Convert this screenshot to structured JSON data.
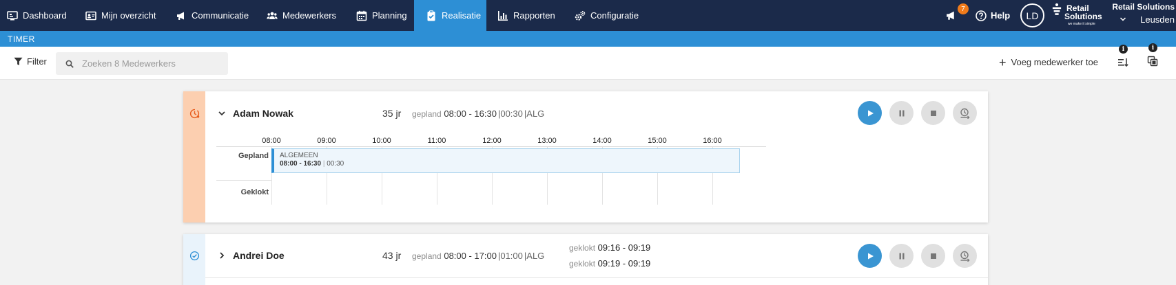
{
  "nav": {
    "items": [
      {
        "label": "Dashboard",
        "icon": "dashboard-icon"
      },
      {
        "label": "Mijn overzicht",
        "icon": "id-card-icon"
      },
      {
        "label": "Communicatie",
        "icon": "megaphone-icon"
      },
      {
        "label": "Medewerkers",
        "icon": "users-icon"
      },
      {
        "label": "Planning",
        "icon": "calendar-icon"
      },
      {
        "label": "Realisatie",
        "icon": "clipboard-icon"
      },
      {
        "label": "Rapporten",
        "icon": "bar-chart-icon"
      },
      {
        "label": "Configuratie",
        "icon": "cogs-icon"
      }
    ],
    "active": "Realisatie",
    "notifications_count": "7",
    "help_label": "Help",
    "avatar_initials": "LD",
    "brand_line1": "Retail",
    "brand_line2": "Solutions",
    "brand_tagline": "we make it simple",
    "company_name": "Retail Solutions",
    "location": "Leusden"
  },
  "subheader": {
    "title": "TIMER"
  },
  "toolbar": {
    "filter_label": "Filter",
    "search_placeholder": "Zoeken 8 Medewerkers",
    "add_employee_label": "Voeg medewerker toe",
    "info_glyph": "i"
  },
  "employees": [
    {
      "name": "Adam Nowak",
      "age": "35 jr",
      "scheduled_prefix": "gepland",
      "scheduled_time": "08:00 - 16:30",
      "scheduled_break": "|00:30",
      "scheduled_dept": "|ALG",
      "expanded": true,
      "status": "late-clock-icon",
      "strip_color": "#fccfb0",
      "timeline": {
        "hours": [
          "08:00",
          "09:00",
          "10:00",
          "11:00",
          "12:00",
          "13:00",
          "14:00",
          "15:00",
          "16:00"
        ],
        "row_planned": "Gepland",
        "row_clocked": "Geklokt",
        "shift": {
          "dept": "ALGEMEEN",
          "time": "08:00 - 16:30",
          "separator": "|",
          "break": "00:30",
          "start_hour": 8.0,
          "end_hour": 16.5
        }
      }
    },
    {
      "name": "Andrei Doe",
      "age": "43 jr",
      "scheduled_prefix": "gepland",
      "scheduled_time": "08:00 - 17:00",
      "scheduled_break": "|01:00",
      "scheduled_dept": "|ALG",
      "expanded": false,
      "status": "check-circle-icon",
      "strip_color": "#e9f3fb",
      "clocked": [
        {
          "prefix": "geklokt",
          "time": "09:16 - 09:19"
        },
        {
          "prefix": "geklokt",
          "time": "09:19 - 09:19"
        }
      ]
    }
  ],
  "colors": {
    "nav_bg": "#1b2a4a",
    "accent": "#2d8fd5",
    "badge": "#f07b1b",
    "play": "#3a95d2"
  }
}
